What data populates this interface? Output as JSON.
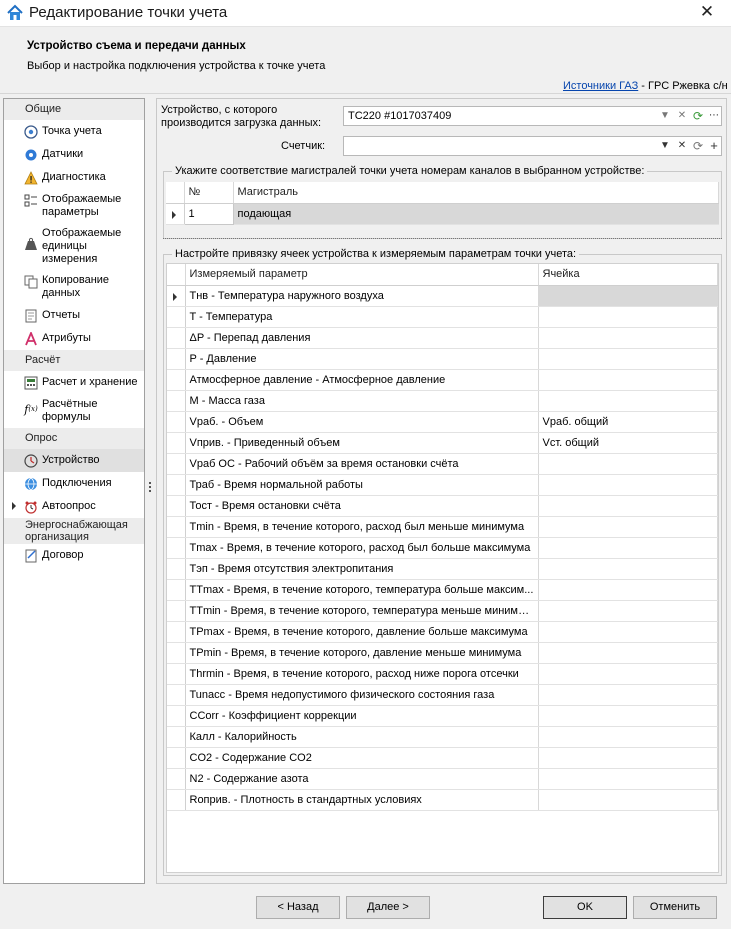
{
  "window": {
    "title": "Редактирование точки учета"
  },
  "header": {
    "title": "Устройство съема и передачи данных",
    "subtitle": "Выбор и настройка подключения устройства к точке учета",
    "crumb_link": "Источники ГАЗ",
    "crumb_rest": " - ГРС Ржевка с/н"
  },
  "nav": {
    "groups": [
      {
        "label": "Общие",
        "items": [
          {
            "label": "Точка учета",
            "icon": "target-icon"
          },
          {
            "label": "Датчики",
            "icon": "sensor-icon"
          },
          {
            "label": "Диагностика",
            "icon": "warning-icon"
          },
          {
            "label": "Отображаемые параметры",
            "icon": "checklist-icon"
          },
          {
            "label": "Отображаемые единицы измерения",
            "icon": "weight-icon"
          },
          {
            "label": "Копирование данных",
            "icon": "copy-icon"
          },
          {
            "label": "Отчеты",
            "icon": "report-icon"
          },
          {
            "label": "Атрибуты",
            "icon": "attribute-icon"
          }
        ]
      },
      {
        "label": "Расчёт",
        "items": [
          {
            "label": "Расчет и хранение",
            "icon": "calculator-icon"
          },
          {
            "label": "Расчётные формулы",
            "icon": "formula-icon"
          }
        ]
      },
      {
        "label": "Опрос",
        "items": [
          {
            "label": "Устройство",
            "icon": "device-icon"
          },
          {
            "label": "Подключения",
            "icon": "globe-icon"
          },
          {
            "label": "Автоопрос",
            "icon": "alarm-clock-icon"
          }
        ]
      },
      {
        "label": "Энергоснабжающая организация",
        "items": [
          {
            "label": "Договор",
            "icon": "contract-icon"
          }
        ]
      }
    ]
  },
  "device": {
    "label": "Устройство, с которого производится загрузка данных:",
    "value": "TC220 #1017037409",
    "counter_label": "Счетчик:",
    "counter_value": ""
  },
  "channels": {
    "legend": "Укажите соответствие магистралей точки учета номерам каналов в выбранном устройстве:",
    "col_num": "№",
    "col_main": "Магистраль",
    "rows": [
      {
        "num": "1",
        "main": "подающая"
      }
    ]
  },
  "cells": {
    "legend": "Настройте привязку ячеек устройства к измеряемым параметрам точки учета:",
    "col_param": "Измеряемый параметр",
    "col_cell": "Ячейка",
    "rows": [
      {
        "param": "Тнв - Температура наружного воздуха",
        "cell": ""
      },
      {
        "param": "T - Температура",
        "cell": ""
      },
      {
        "param": "ΔP - Перепад давления",
        "cell": ""
      },
      {
        "param": "P - Давление",
        "cell": ""
      },
      {
        "param": "Атмосферное давление - Атмосферное давление",
        "cell": ""
      },
      {
        "param": "M - Масса газа",
        "cell": ""
      },
      {
        "param": "Vраб. - Объем",
        "cell": "Vраб. общий"
      },
      {
        "param": "Vприв. - Приведенный объем",
        "cell": "Vст. общий"
      },
      {
        "param": "Vраб ОС - Рабочий объём за время остановки счёта",
        "cell": ""
      },
      {
        "param": "Траб - Время нормальной работы",
        "cell": ""
      },
      {
        "param": "Тост - Время остановки счёта",
        "cell": ""
      },
      {
        "param": "Tmin - Время, в течение которого, расход был меньше минимума",
        "cell": ""
      },
      {
        "param": "Tmax - Время, в течение которого, расход был больше максимума",
        "cell": ""
      },
      {
        "param": "Тэп - Время отсутствия электропитания",
        "cell": ""
      },
      {
        "param": "TTmax - Время, в течение которого, температура больше максим...",
        "cell": ""
      },
      {
        "param": "TTmin - Время, в течение которого, температура меньше минимума",
        "cell": ""
      },
      {
        "param": "TPmax - Время, в течение которого, давление больше максимума",
        "cell": ""
      },
      {
        "param": "TPmin - Время, в течение которого, давление меньше минимума",
        "cell": ""
      },
      {
        "param": "Thrmin - Время, в течение которого, расход ниже порога отсечки",
        "cell": ""
      },
      {
        "param": "Tunacc - Время недопустимого физического состояния газа",
        "cell": ""
      },
      {
        "param": "CCorr - Коэффициент коррекции",
        "cell": ""
      },
      {
        "param": "Калл - Калорийность",
        "cell": ""
      },
      {
        "param": "CO2 - Содержание CO2",
        "cell": ""
      },
      {
        "param": "N2 - Содержание азота",
        "cell": ""
      },
      {
        "param": "Rоприв. - Плотность в стандартных условиях",
        "cell": ""
      }
    ]
  },
  "footer": {
    "back": "< Назад",
    "next": "Далее >",
    "ok": "OK",
    "cancel": "Отменить"
  }
}
